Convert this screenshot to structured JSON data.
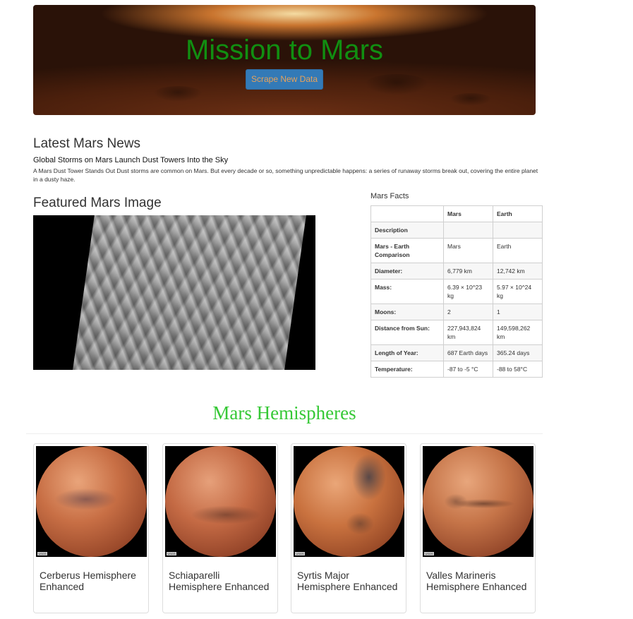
{
  "header": {
    "title": "Mission to Mars",
    "scrape_button": "Scrape New Data"
  },
  "news": {
    "heading": "Latest Mars News",
    "title": "Global Storms on Mars Launch Dust Towers Into the Sky",
    "paragraph": "A Mars Dust Tower Stands Out Dust storms are common on Mars. But every decade or so, something unpredictable happens: a series of runaway storms break out, covering the entire planet in a dusty haze."
  },
  "featured": {
    "heading": "Featured Mars Image"
  },
  "facts": {
    "heading": "Mars Facts",
    "columns": [
      "",
      "Mars",
      "Earth"
    ],
    "rows": [
      {
        "label": "Description",
        "mars": "",
        "earth": ""
      },
      {
        "label": "Mars - Earth Comparison",
        "mars": "Mars",
        "earth": "Earth"
      },
      {
        "label": "Diameter:",
        "mars": "6,779 km",
        "earth": "12,742 km"
      },
      {
        "label": "Mass:",
        "mars": "6.39 × 10^23 kg",
        "earth": "5.97 × 10^24 kg"
      },
      {
        "label": "Moons:",
        "mars": "2",
        "earth": "1"
      },
      {
        "label": "Distance from Sun:",
        "mars": "227,943,824 km",
        "earth": "149,598,262 km"
      },
      {
        "label": "Length of Year:",
        "mars": "687 Earth days",
        "earth": "365.24 days"
      },
      {
        "label": "Temperature:",
        "mars": "-87 to -5 °C",
        "earth": "-88 to 58°C"
      }
    ]
  },
  "hemispheres": {
    "heading": "Mars Hemispheres",
    "items": [
      {
        "title": "Cerberus Hemisphere Enhanced",
        "usgs": "USGS"
      },
      {
        "title": "Schiaparelli Hemisphere Enhanced",
        "usgs": "USGS"
      },
      {
        "title": "Syrtis Major Hemisphere Enhanced",
        "usgs": "USGS"
      },
      {
        "title": "Valles Marineris Hemisphere Enhanced",
        "usgs": "USGS"
      }
    ]
  },
  "colors": {
    "title_green": "#118f11",
    "hemi_heading_green": "#35c835",
    "button_blue": "#337ab7"
  }
}
